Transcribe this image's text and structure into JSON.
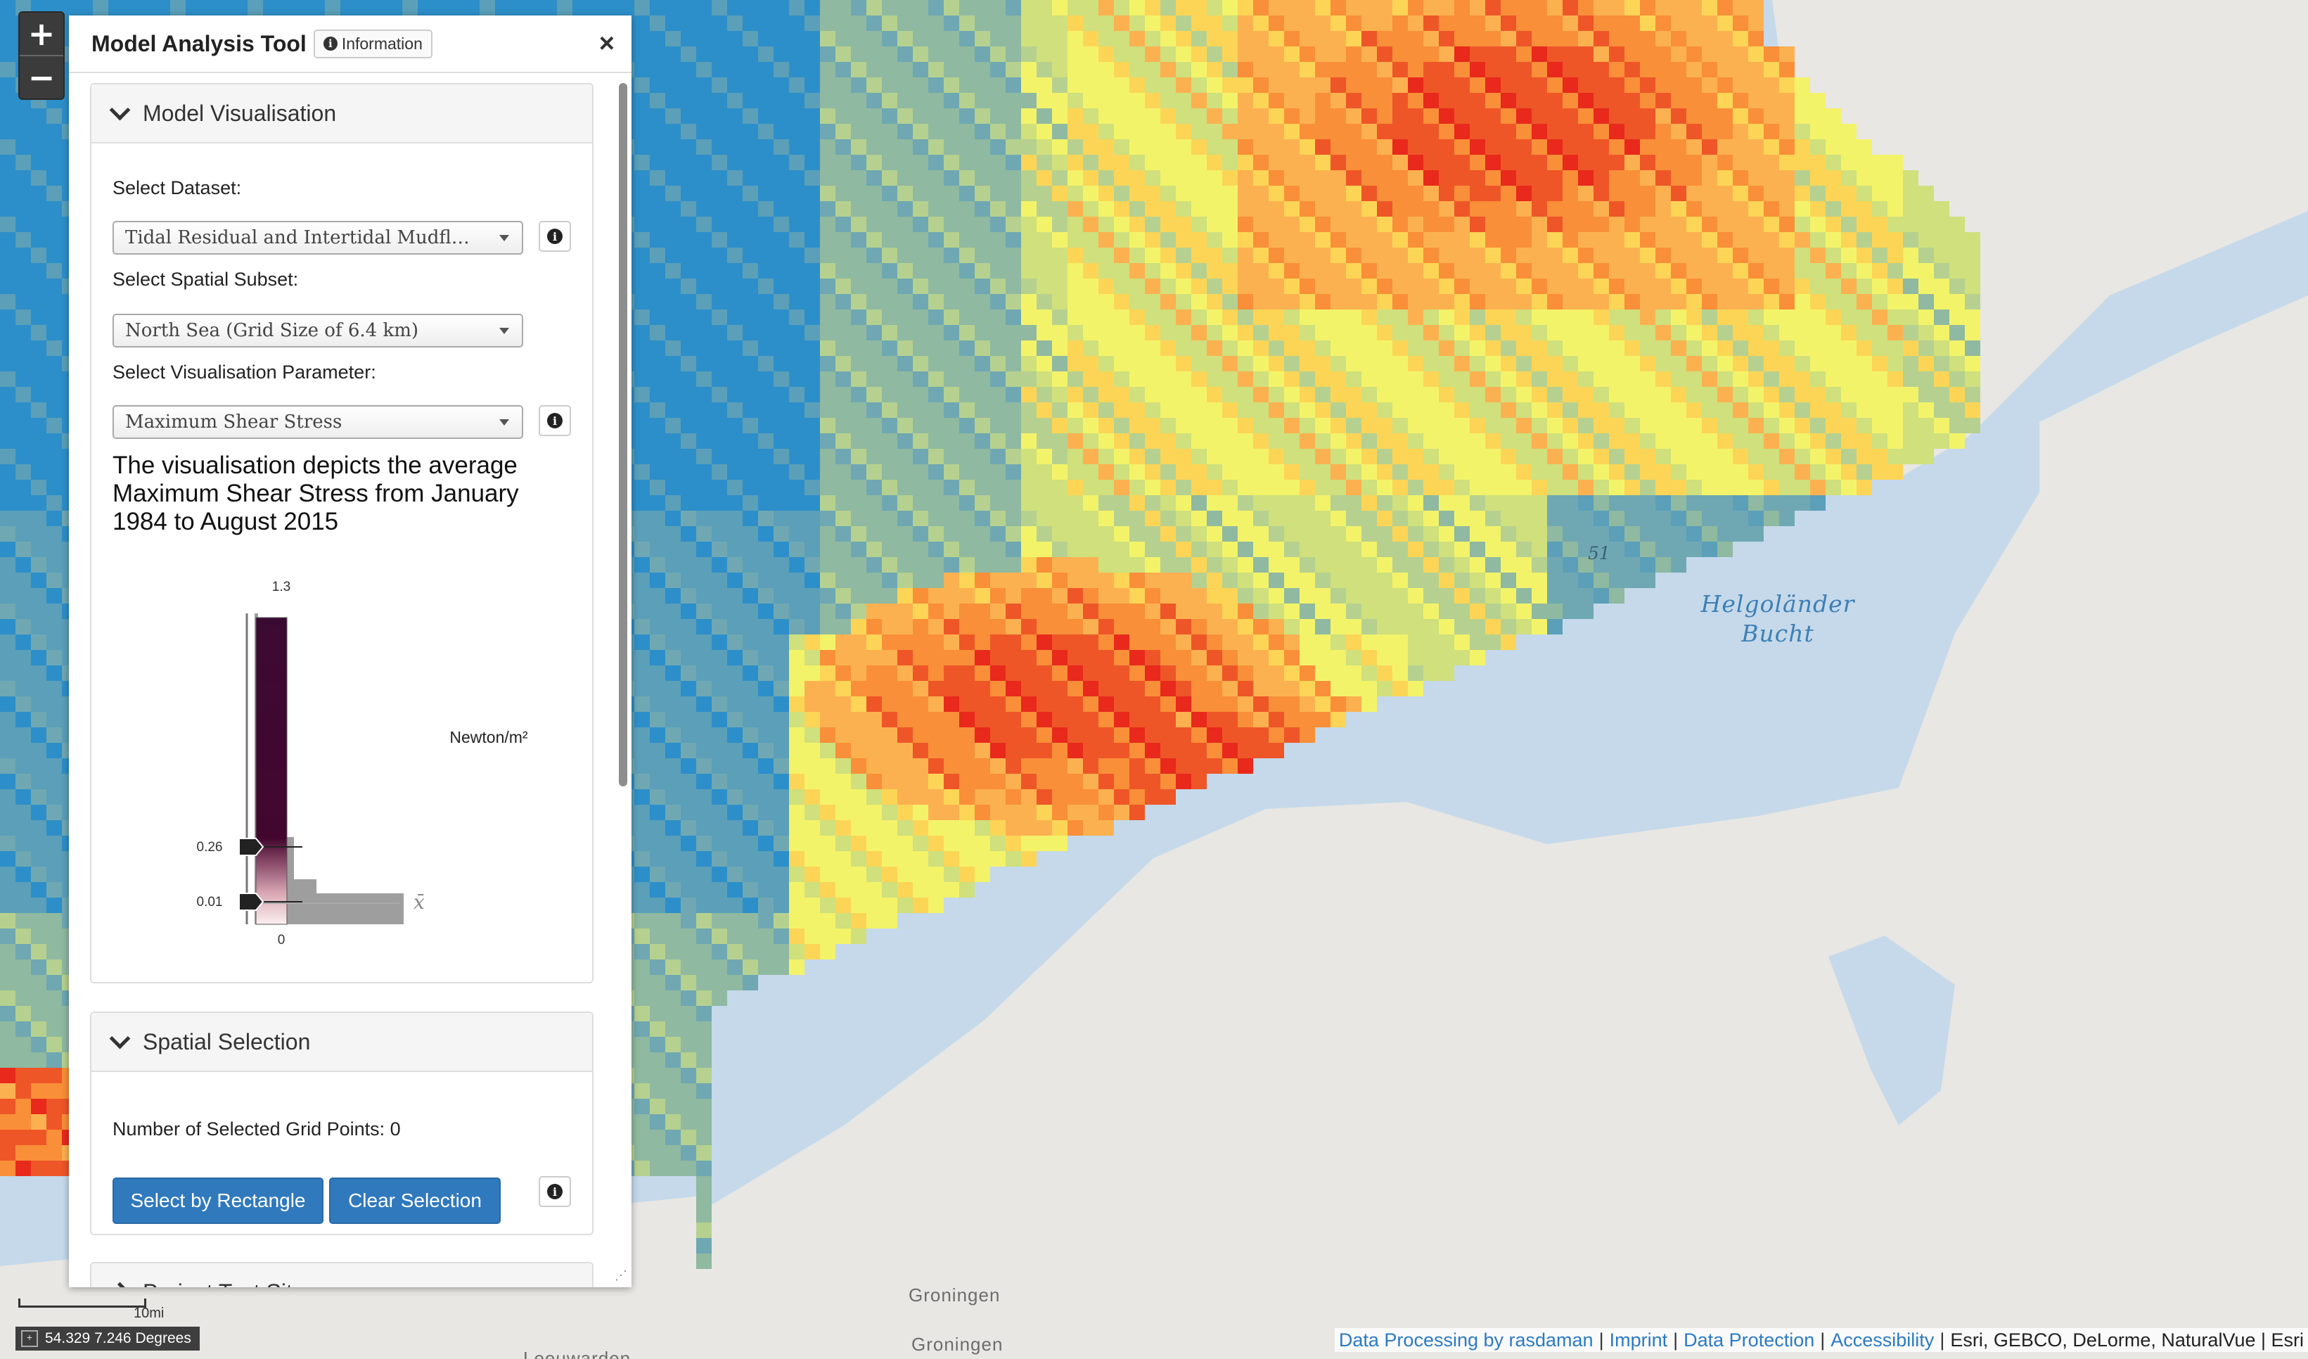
{
  "map": {
    "zoom_in": "+",
    "zoom_out": "−",
    "sea_label": "Helgoländer\nBucht",
    "depth_label": "51",
    "city_labels": [
      "Groningen",
      "Groningen",
      "Leeuwarden"
    ],
    "scale_label": "10mi",
    "coords": "54.329 7.246 Degrees",
    "attribution": {
      "links": [
        "Data Processing by rasdaman",
        "Imprint",
        "Data Protection",
        "Accessibility"
      ],
      "credits": "Esri, GEBCO, DeLorme, NaturalVue | Esri"
    },
    "palette": [
      "#2d8fc9",
      "#5b9fb9",
      "#6fa8b3",
      "#8fb9a0",
      "#b6d18f",
      "#cfe07c",
      "#f3f36a",
      "#fcd556",
      "#fcb150",
      "#f98f38",
      "#ee5628",
      "#e8291c"
    ]
  },
  "panel": {
    "title": "Model Analysis Tool",
    "info_label": "Information",
    "close": "×",
    "sections": {
      "model_vis": {
        "header": "Model Visualisation",
        "dataset_label": "Select Dataset:",
        "dataset_value": "Tidal Residual and Intertidal Mudflat (TRIM)",
        "subset_label": "Select Spatial Subset:",
        "subset_value": "North Sea (Grid Size of 6.4 km)",
        "param_label": "Select Visualisation Parameter:",
        "param_value": "Maximum Shear Stress",
        "description": "The visualisation depicts the average Maximum Shear Stress from January 1984 to August 2015",
        "legend": {
          "max_label": "1.3",
          "handle_upper": "0.26",
          "handle_lower": "0.01",
          "min_label": "0",
          "unit": "Newton/m²",
          "mean_symbol": "x̄"
        }
      },
      "spatial": {
        "header": "Spatial Selection",
        "count_label": "Number of Selected Grid Points: 0",
        "select_rect": "Select by Rectangle",
        "clear": "Clear Selection"
      },
      "third": {
        "header": "Project Test Sites"
      }
    }
  }
}
